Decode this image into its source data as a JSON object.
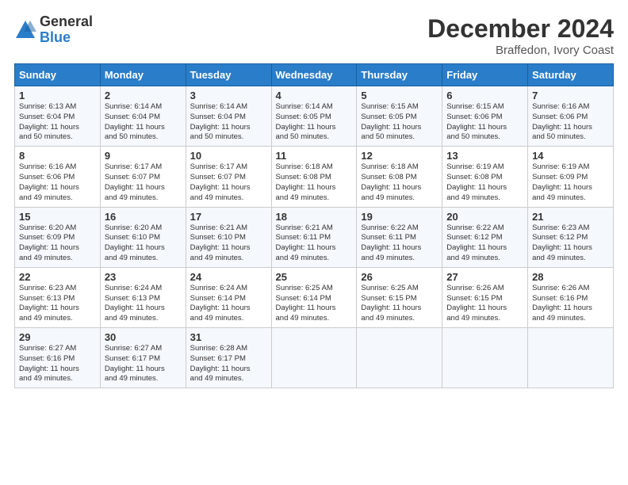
{
  "logo": {
    "general": "General",
    "blue": "Blue"
  },
  "title": "December 2024",
  "subtitle": "Braffedon, Ivory Coast",
  "days_header": [
    "Sunday",
    "Monday",
    "Tuesday",
    "Wednesday",
    "Thursday",
    "Friday",
    "Saturday"
  ],
  "weeks": [
    [
      {
        "day": "1",
        "info": "Sunrise: 6:13 AM\nSunset: 6:04 PM\nDaylight: 11 hours\nand 50 minutes."
      },
      {
        "day": "2",
        "info": "Sunrise: 6:14 AM\nSunset: 6:04 PM\nDaylight: 11 hours\nand 50 minutes."
      },
      {
        "day": "3",
        "info": "Sunrise: 6:14 AM\nSunset: 6:04 PM\nDaylight: 11 hours\nand 50 minutes."
      },
      {
        "day": "4",
        "info": "Sunrise: 6:14 AM\nSunset: 6:05 PM\nDaylight: 11 hours\nand 50 minutes."
      },
      {
        "day": "5",
        "info": "Sunrise: 6:15 AM\nSunset: 6:05 PM\nDaylight: 11 hours\nand 50 minutes."
      },
      {
        "day": "6",
        "info": "Sunrise: 6:15 AM\nSunset: 6:06 PM\nDaylight: 11 hours\nand 50 minutes."
      },
      {
        "day": "7",
        "info": "Sunrise: 6:16 AM\nSunset: 6:06 PM\nDaylight: 11 hours\nand 50 minutes."
      }
    ],
    [
      {
        "day": "8",
        "info": "Sunrise: 6:16 AM\nSunset: 6:06 PM\nDaylight: 11 hours\nand 49 minutes."
      },
      {
        "day": "9",
        "info": "Sunrise: 6:17 AM\nSunset: 6:07 PM\nDaylight: 11 hours\nand 49 minutes."
      },
      {
        "day": "10",
        "info": "Sunrise: 6:17 AM\nSunset: 6:07 PM\nDaylight: 11 hours\nand 49 minutes."
      },
      {
        "day": "11",
        "info": "Sunrise: 6:18 AM\nSunset: 6:08 PM\nDaylight: 11 hours\nand 49 minutes."
      },
      {
        "day": "12",
        "info": "Sunrise: 6:18 AM\nSunset: 6:08 PM\nDaylight: 11 hours\nand 49 minutes."
      },
      {
        "day": "13",
        "info": "Sunrise: 6:19 AM\nSunset: 6:08 PM\nDaylight: 11 hours\nand 49 minutes."
      },
      {
        "day": "14",
        "info": "Sunrise: 6:19 AM\nSunset: 6:09 PM\nDaylight: 11 hours\nand 49 minutes."
      }
    ],
    [
      {
        "day": "15",
        "info": "Sunrise: 6:20 AM\nSunset: 6:09 PM\nDaylight: 11 hours\nand 49 minutes."
      },
      {
        "day": "16",
        "info": "Sunrise: 6:20 AM\nSunset: 6:10 PM\nDaylight: 11 hours\nand 49 minutes."
      },
      {
        "day": "17",
        "info": "Sunrise: 6:21 AM\nSunset: 6:10 PM\nDaylight: 11 hours\nand 49 minutes."
      },
      {
        "day": "18",
        "info": "Sunrise: 6:21 AM\nSunset: 6:11 PM\nDaylight: 11 hours\nand 49 minutes."
      },
      {
        "day": "19",
        "info": "Sunrise: 6:22 AM\nSunset: 6:11 PM\nDaylight: 11 hours\nand 49 minutes."
      },
      {
        "day": "20",
        "info": "Sunrise: 6:22 AM\nSunset: 6:12 PM\nDaylight: 11 hours\nand 49 minutes."
      },
      {
        "day": "21",
        "info": "Sunrise: 6:23 AM\nSunset: 6:12 PM\nDaylight: 11 hours\nand 49 minutes."
      }
    ],
    [
      {
        "day": "22",
        "info": "Sunrise: 6:23 AM\nSunset: 6:13 PM\nDaylight: 11 hours\nand 49 minutes."
      },
      {
        "day": "23",
        "info": "Sunrise: 6:24 AM\nSunset: 6:13 PM\nDaylight: 11 hours\nand 49 minutes."
      },
      {
        "day": "24",
        "info": "Sunrise: 6:24 AM\nSunset: 6:14 PM\nDaylight: 11 hours\nand 49 minutes."
      },
      {
        "day": "25",
        "info": "Sunrise: 6:25 AM\nSunset: 6:14 PM\nDaylight: 11 hours\nand 49 minutes."
      },
      {
        "day": "26",
        "info": "Sunrise: 6:25 AM\nSunset: 6:15 PM\nDaylight: 11 hours\nand 49 minutes."
      },
      {
        "day": "27",
        "info": "Sunrise: 6:26 AM\nSunset: 6:15 PM\nDaylight: 11 hours\nand 49 minutes."
      },
      {
        "day": "28",
        "info": "Sunrise: 6:26 AM\nSunset: 6:16 PM\nDaylight: 11 hours\nand 49 minutes."
      }
    ],
    [
      {
        "day": "29",
        "info": "Sunrise: 6:27 AM\nSunset: 6:16 PM\nDaylight: 11 hours\nand 49 minutes."
      },
      {
        "day": "30",
        "info": "Sunrise: 6:27 AM\nSunset: 6:17 PM\nDaylight: 11 hours\nand 49 minutes."
      },
      {
        "day": "31",
        "info": "Sunrise: 6:28 AM\nSunset: 6:17 PM\nDaylight: 11 hours\nand 49 minutes."
      },
      {
        "day": "",
        "info": ""
      },
      {
        "day": "",
        "info": ""
      },
      {
        "day": "",
        "info": ""
      },
      {
        "day": "",
        "info": ""
      }
    ]
  ]
}
